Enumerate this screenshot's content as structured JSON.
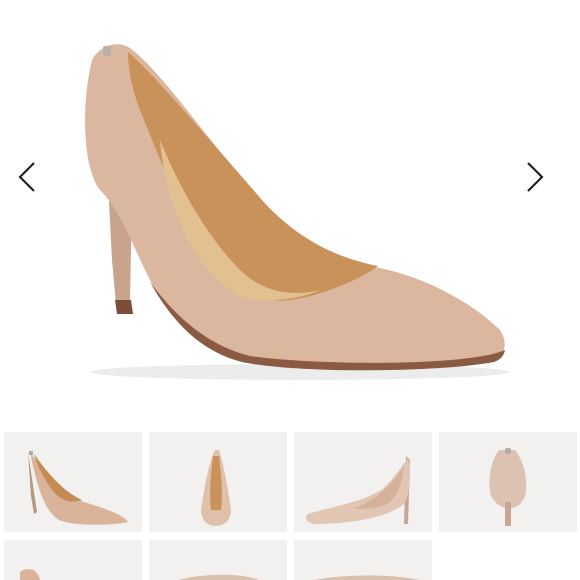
{
  "product": {
    "type": "pointed-toe stiletto pump",
    "color_hex": "#d8b39c",
    "lining_hex": "#c8935d",
    "sole_hex": "#6e4331"
  },
  "gallery": {
    "prev_icon": "chevron-left-icon",
    "next_icon": "chevron-right-icon",
    "thumbnails": [
      {
        "view": "side-angle"
      },
      {
        "view": "front"
      },
      {
        "view": "side"
      },
      {
        "view": "back"
      },
      {
        "view": "partial"
      },
      {
        "view": "partial"
      },
      {
        "view": "partial"
      }
    ]
  }
}
